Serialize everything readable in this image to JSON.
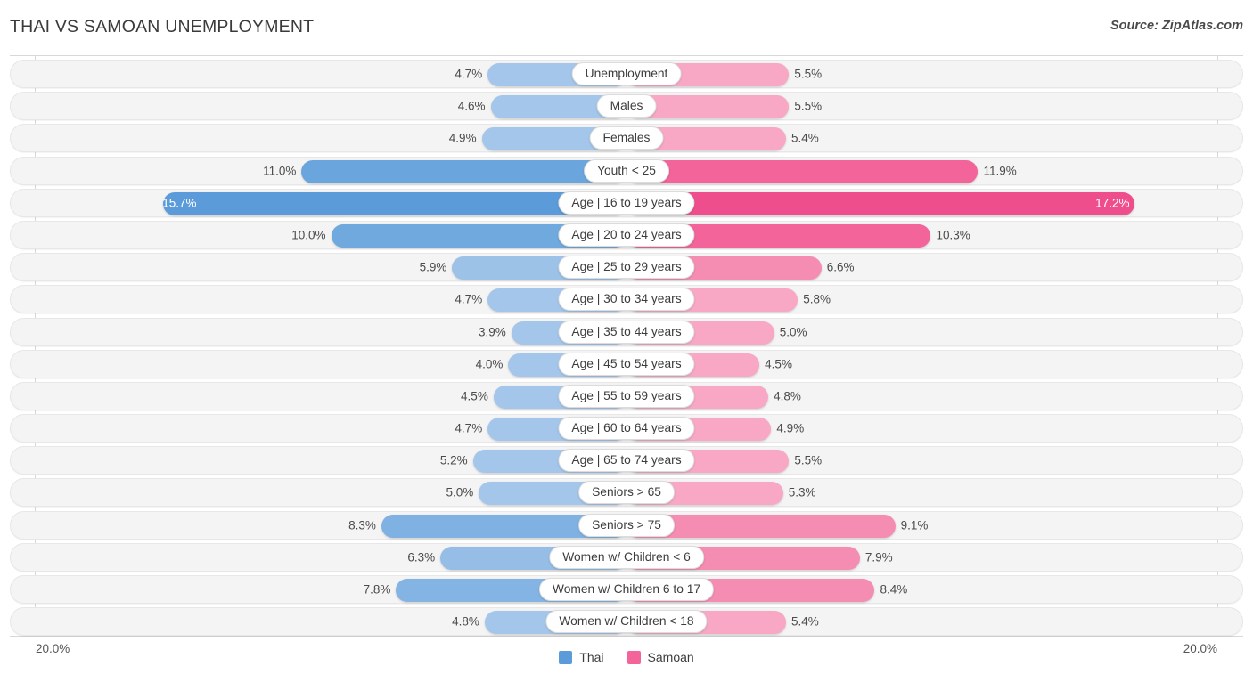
{
  "header": {
    "title": "THAI VS SAMOAN UNEMPLOYMENT",
    "source": "Source: ZipAtlas.com"
  },
  "axis": {
    "left_label": "20.0%",
    "right_label": "20.0%",
    "max": 20.0
  },
  "legend": {
    "items": [
      {
        "label": "Thai",
        "color": "#5b9bd9"
      },
      {
        "label": "Samoan",
        "color": "#f2649a"
      }
    ]
  },
  "colors": {
    "thai_light": "#a3c6ea",
    "thai_mid": "#7fb1e2",
    "thai_dark": "#5b9bd9",
    "samoan_light": "#f8a8c4",
    "samoan_mid": "#f58cb1",
    "samoan_dark": "#f2649a",
    "samoan_deep": "#ee4f8c",
    "row_bg": "#f4f4f4",
    "frame": "#d8d8d8"
  },
  "chart_data": {
    "type": "bar",
    "orientation": "horizontal-diverging",
    "title": "THAI VS SAMOAN UNEMPLOYMENT",
    "xlabel": "",
    "ylabel": "",
    "xlim": [
      20.0,
      20.0
    ],
    "grid": false,
    "legend_position": "bottom-center",
    "categories": [
      "Unemployment",
      "Males",
      "Females",
      "Youth < 25",
      "Age | 16 to 19 years",
      "Age | 20 to 24 years",
      "Age | 25 to 29 years",
      "Age | 30 to 34 years",
      "Age | 35 to 44 years",
      "Age | 45 to 54 years",
      "Age | 55 to 59 years",
      "Age | 60 to 64 years",
      "Age | 65 to 74 years",
      "Seniors > 65",
      "Seniors > 75",
      "Women w/ Children < 6",
      "Women w/ Children 6 to 17",
      "Women w/ Children < 18"
    ],
    "series": [
      {
        "name": "Thai",
        "values": [
          4.7,
          4.6,
          4.9,
          11.0,
          15.7,
          10.0,
          5.9,
          4.7,
          3.9,
          4.0,
          4.5,
          4.7,
          5.2,
          5.0,
          8.3,
          6.3,
          7.8,
          4.8
        ]
      },
      {
        "name": "Samoan",
        "values": [
          5.5,
          5.5,
          5.4,
          11.9,
          17.2,
          10.3,
          6.6,
          5.8,
          5.0,
          4.5,
          4.8,
          4.9,
          5.5,
          5.3,
          9.1,
          7.9,
          8.4,
          5.4
        ]
      }
    ]
  },
  "rows": [
    {
      "label": "Unemployment",
      "left": "4.7%",
      "right": "5.5%",
      "lv": 4.7,
      "rv": 5.5,
      "lc": "#a3c6ea",
      "rc": "#f8a8c4",
      "l_in": false,
      "r_in": false
    },
    {
      "label": "Males",
      "left": "4.6%",
      "right": "5.5%",
      "lv": 4.6,
      "rv": 5.5,
      "lc": "#a3c6ea",
      "rc": "#f8a8c4",
      "l_in": false,
      "r_in": false
    },
    {
      "label": "Females",
      "left": "4.9%",
      "right": "5.4%",
      "lv": 4.9,
      "rv": 5.4,
      "lc": "#a3c6ea",
      "rc": "#f8a8c4",
      "l_in": false,
      "r_in": false
    },
    {
      "label": "Youth < 25",
      "left": "11.0%",
      "right": "11.9%",
      "lv": 11.0,
      "rv": 11.9,
      "lc": "#6aa6dd",
      "rc": "#f2649a",
      "l_in": false,
      "r_in": false
    },
    {
      "label": "Age | 16 to 19 years",
      "left": "15.7%",
      "right": "17.2%",
      "lv": 15.7,
      "rv": 17.2,
      "lc": "#5b9bd9",
      "rc": "#ee4f8c",
      "l_in": true,
      "r_in": true
    },
    {
      "label": "Age | 20 to 24 years",
      "left": "10.0%",
      "right": "10.3%",
      "lv": 10.0,
      "rv": 10.3,
      "lc": "#6fa9de",
      "rc": "#f2649a",
      "l_in": false,
      "r_in": false
    },
    {
      "label": "Age | 25 to 29 years",
      "left": "5.9%",
      "right": "6.6%",
      "lv": 5.9,
      "rv": 6.6,
      "lc": "#9cc2e8",
      "rc": "#f58cb1",
      "l_in": false,
      "r_in": false
    },
    {
      "label": "Age | 30 to 34 years",
      "left": "4.7%",
      "right": "5.8%",
      "lv": 4.7,
      "rv": 5.8,
      "lc": "#a3c6ea",
      "rc": "#f8a8c4",
      "l_in": false,
      "r_in": false
    },
    {
      "label": "Age | 35 to 44 years",
      "left": "3.9%",
      "right": "5.0%",
      "lv": 3.9,
      "rv": 5.0,
      "lc": "#a3c6ea",
      "rc": "#f8a8c4",
      "l_in": false,
      "r_in": false
    },
    {
      "label": "Age | 45 to 54 years",
      "left": "4.0%",
      "right": "4.5%",
      "lv": 4.0,
      "rv": 4.5,
      "lc": "#a3c6ea",
      "rc": "#f8a8c4",
      "l_in": false,
      "r_in": false
    },
    {
      "label": "Age | 55 to 59 years",
      "left": "4.5%",
      "right": "4.8%",
      "lv": 4.5,
      "rv": 4.8,
      "lc": "#a3c6ea",
      "rc": "#f8a8c4",
      "l_in": false,
      "r_in": false
    },
    {
      "label": "Age | 60 to 64 years",
      "left": "4.7%",
      "right": "4.9%",
      "lv": 4.7,
      "rv": 4.9,
      "lc": "#a3c6ea",
      "rc": "#f8a8c4",
      "l_in": false,
      "r_in": false
    },
    {
      "label": "Age | 65 to 74 years",
      "left": "5.2%",
      "right": "5.5%",
      "lv": 5.2,
      "rv": 5.5,
      "lc": "#a3c6ea",
      "rc": "#f8a8c4",
      "l_in": false,
      "r_in": false
    },
    {
      "label": "Seniors > 65",
      "left": "5.0%",
      "right": "5.3%",
      "lv": 5.0,
      "rv": 5.3,
      "lc": "#a3c6ea",
      "rc": "#f8a8c4",
      "l_in": false,
      "r_in": false
    },
    {
      "label": "Seniors > 75",
      "left": "8.3%",
      "right": "9.1%",
      "lv": 8.3,
      "rv": 9.1,
      "lc": "#7fb1e2",
      "rc": "#f58cb1",
      "l_in": false,
      "r_in": false
    },
    {
      "label": "Women w/ Children < 6",
      "left": "6.3%",
      "right": "7.9%",
      "lv": 6.3,
      "rv": 7.9,
      "lc": "#95bde6",
      "rc": "#f58cb1",
      "l_in": false,
      "r_in": false
    },
    {
      "label": "Women w/ Children 6 to 17",
      "left": "7.8%",
      "right": "8.4%",
      "lv": 7.8,
      "rv": 8.4,
      "lc": "#84b4e3",
      "rc": "#f58cb1",
      "l_in": false,
      "r_in": false
    },
    {
      "label": "Women w/ Children < 18",
      "left": "4.8%",
      "right": "5.4%",
      "lv": 4.8,
      "rv": 5.4,
      "lc": "#a3c6ea",
      "rc": "#f8a8c4",
      "l_in": false,
      "r_in": false
    }
  ]
}
